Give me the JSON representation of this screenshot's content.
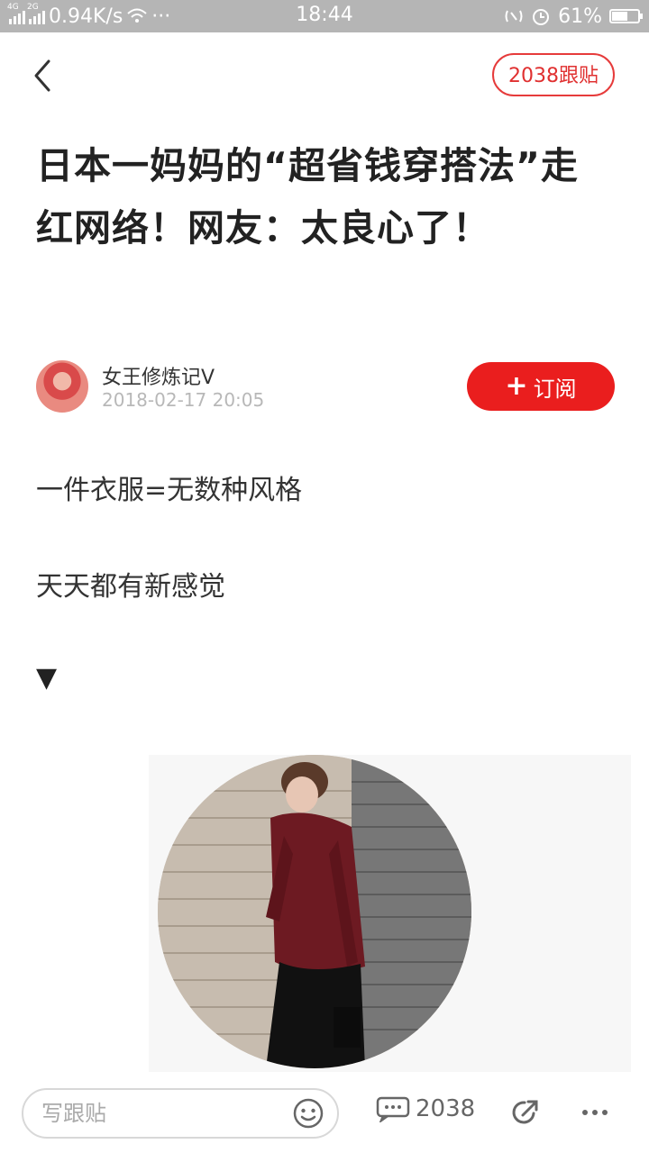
{
  "status_bar": {
    "network_speed": "0.94K/s",
    "dots": "···",
    "time": "18:44",
    "battery_percent": "61%",
    "battery_level": 0.61,
    "signal_4g_label": "4G",
    "signal_2g_label": "2G"
  },
  "header": {
    "comments_pill": "2038跟贴"
  },
  "article": {
    "title": "日本一妈妈的“超省钱穿搭法”走红网络！网友：太良心了！",
    "author": "女王修炼记V",
    "time": "2018-02-17 20:05",
    "subscribe_label": "订阅",
    "subscribe_plus": "+",
    "paragraphs": [
      "一件衣服=无数种风格",
      "天天都有新感觉"
    ],
    "arrow": "▼"
  },
  "bottom_bar": {
    "input_placeholder": "写跟贴",
    "comment_count": "2038"
  },
  "colors": {
    "accent": "#ea1e1e",
    "status_bar": "#b5b5b5"
  },
  "icons": [
    "back-icon",
    "smiley-icon",
    "comment-icon",
    "share-icon",
    "more-icon",
    "wifi-icon",
    "alarm-icon",
    "nfc-icon"
  ]
}
